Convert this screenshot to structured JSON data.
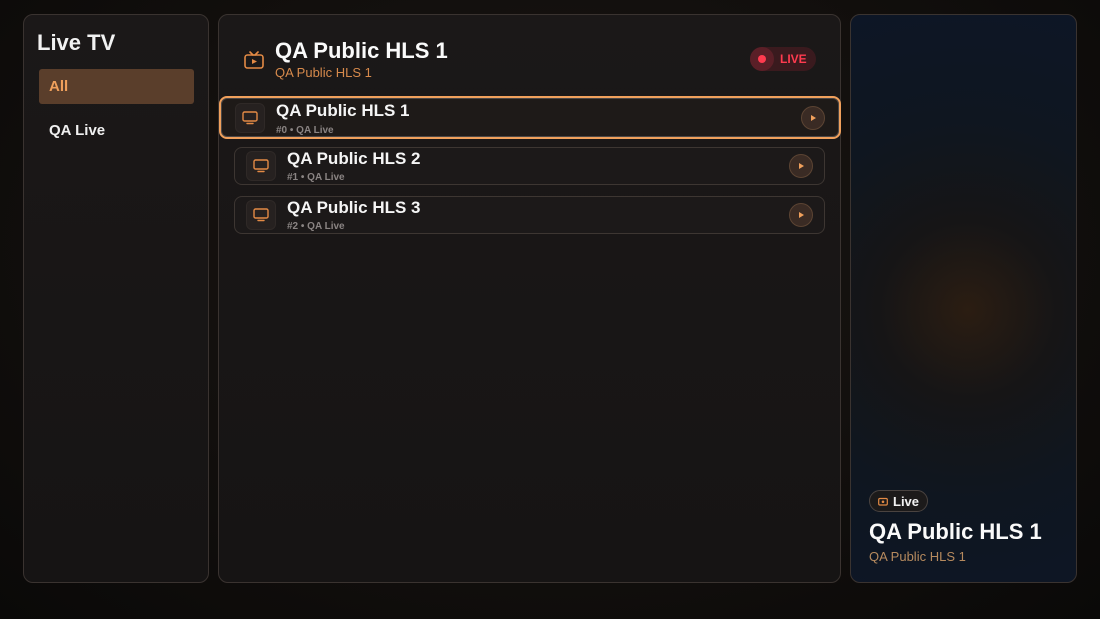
{
  "sidebar": {
    "title": "Live TV",
    "categories": [
      {
        "label": "All",
        "active": true
      },
      {
        "label": "QA Live",
        "active": false
      }
    ]
  },
  "header": {
    "title": "QA Public HLS 1",
    "subtitle": "QA Public HLS 1",
    "icon": "tv-play-icon",
    "live_label": "LIVE"
  },
  "channels": [
    {
      "name": "QA Public HLS 1",
      "meta": "#0 • QA Live",
      "focused": true
    },
    {
      "name": "QA Public HLS 2",
      "meta": "#1 • QA Live",
      "focused": false
    },
    {
      "name": "QA Public HLS 3",
      "meta": "#2 • QA Live",
      "focused": false
    }
  ],
  "preview": {
    "chip_label": "Live",
    "title": "QA Public HLS 1",
    "subtitle": "QA Public HLS 1"
  },
  "colors": {
    "accent": "#f0a05c",
    "live_red": "#ff3b4f",
    "active_category_bg": "#5a3e2b"
  }
}
